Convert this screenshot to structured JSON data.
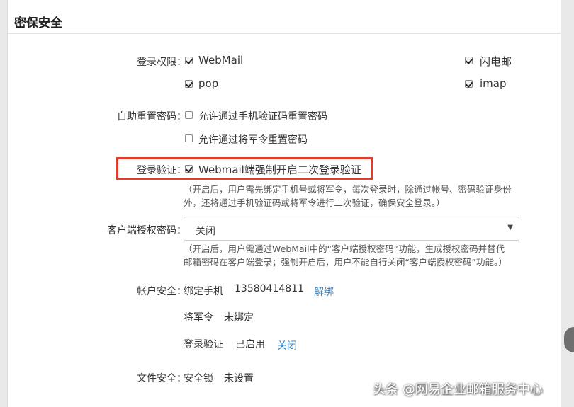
{
  "section_title": "密保安全",
  "login_permission": {
    "label": "登录权限：",
    "options": {
      "webmail": {
        "label": "WebMail",
        "checked": true
      },
      "shandian": {
        "label": "闪电邮",
        "checked": true
      },
      "pop": {
        "label": "pop",
        "checked": true
      },
      "imap": {
        "label": "imap",
        "checked": true
      }
    }
  },
  "self_reset": {
    "label": "自助重置密码：",
    "options": {
      "sms": {
        "label": "允许通过手机验证码重置密码",
        "checked": false
      },
      "token": {
        "label": "允许通过将军令重置密码",
        "checked": false
      }
    }
  },
  "login_verify": {
    "label": "登录验证：",
    "option": {
      "label": "Webmail端强制开启二次登录验证",
      "checked": true
    },
    "hint_line1": "（开启后，用户需先绑定手机号或将军令，每次登录时，除通过帐号、密码验证身份",
    "hint_line2": "外，还将通过手机验证码或将军令进行二次验证，确保安全登录。）"
  },
  "client_auth": {
    "label": "客户端授权密码：",
    "selected": "关闭",
    "hint_line1": "（开启后，用户需通过WebMail中的“客户端授权密码”功能，生成授权密码并替代",
    "hint_line2": "邮箱密码在客户端登录；强制开启后，用户不能自行关闭“客户端授权密码”功能。）"
  },
  "account_security": {
    "label": "帐户安全：",
    "phone_label": "绑定手机",
    "phone_value": "13580414811",
    "unbind_link": "解绑",
    "token_label": "将军令",
    "token_value": "未绑定",
    "verify_label": "登录验证",
    "verify_value": "已启用",
    "close_link": "关闭"
  },
  "file_security": {
    "label": "文件安全：",
    "lock_label": "安全锁",
    "lock_value": "未设置"
  },
  "watermark": "头条 @网易企业邮箱服务中心",
  "colors": {
    "highlight": "#e33a2e",
    "link": "#3b84c4"
  }
}
